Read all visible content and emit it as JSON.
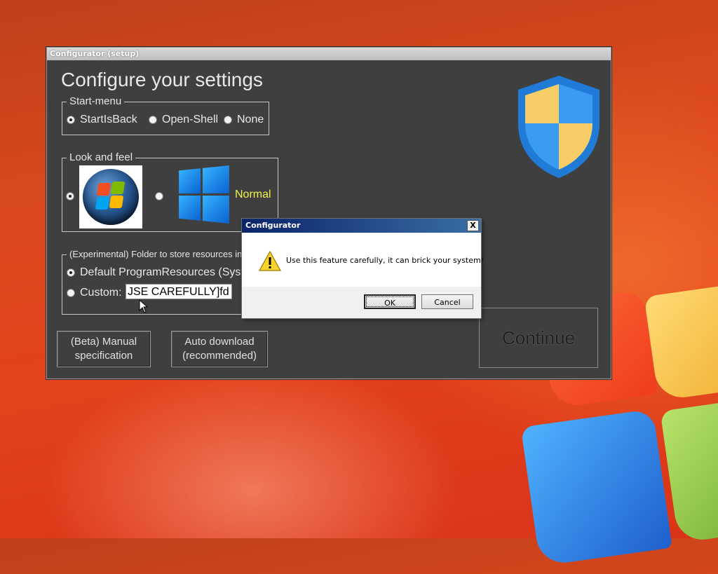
{
  "window": {
    "title": "Configurator (setup)",
    "heading": "Configure your settings"
  },
  "start_menu": {
    "legend": "Start-menu",
    "options": [
      {
        "label": "StartIsBack",
        "checked": true
      },
      {
        "label": "Open-Shell",
        "checked": false
      },
      {
        "label": "None",
        "checked": false
      }
    ]
  },
  "look_and_feel": {
    "legend": "Look and feel",
    "option_classic_checked": true,
    "option_modern_checked": false,
    "modern_label": "Normal"
  },
  "resources": {
    "legend": "(Experimental) Folder to store resources in",
    "default_label": "Default ProgramResources (System",
    "default_checked": true,
    "custom_label": "Custom:",
    "custom_checked": false,
    "custom_value": "JSE CAREFULLY]fd"
  },
  "buttons": {
    "manual_line1": "(Beta) Manual",
    "manual_line2": "specification",
    "auto_line1": "Auto download",
    "auto_line2": "(recommended)",
    "continue": "Continue"
  },
  "dialog": {
    "title": "Configurator",
    "close": "X",
    "message": "Use this feature carefully, it can brick your system!",
    "ok": "OK",
    "cancel": "Cancel",
    "icon": "warning-icon"
  },
  "colors": {
    "window_bg": "#3f3f3f",
    "accent_yellow": "#f2f24a",
    "desktop": "#d8481e"
  }
}
